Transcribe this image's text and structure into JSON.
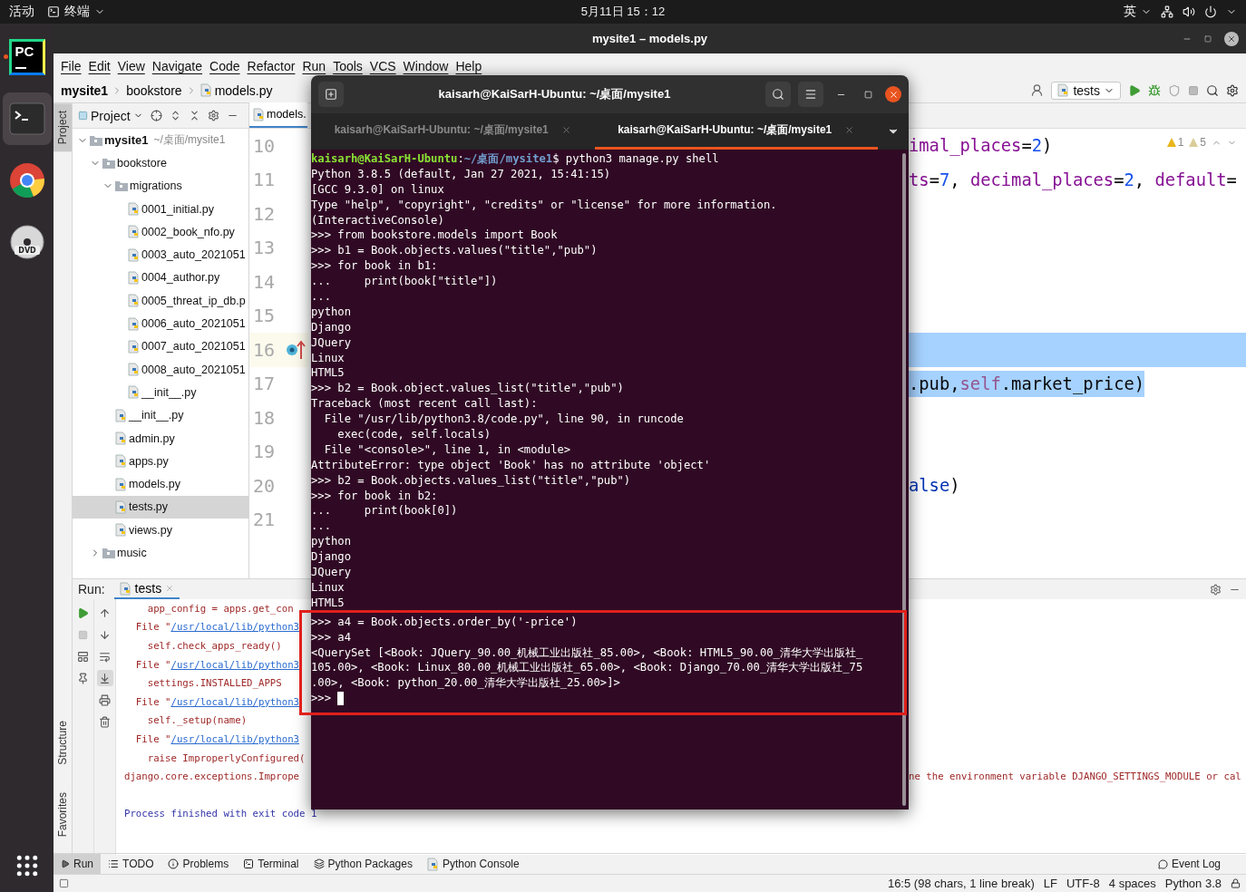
{
  "top_bar": {
    "activities": "活动",
    "app_menu": "终端",
    "clock": "5月11日 15：12",
    "input_method": "英"
  },
  "dock": {
    "items": [
      {
        "kind": "pycharm",
        "label": "PC",
        "running": true,
        "selected": false
      },
      {
        "kind": "terminal",
        "running": false,
        "selected": true
      },
      {
        "kind": "chrome",
        "running": false,
        "selected": false
      },
      {
        "kind": "dvd",
        "label": "DVD",
        "running": false,
        "selected": false
      }
    ]
  },
  "ide": {
    "title": "mysite1 – models.py",
    "menu": [
      "File",
      "Edit",
      "View",
      "Navigate",
      "Code",
      "Refactor",
      "Run",
      "Tools",
      "VCS",
      "Window",
      "Help"
    ],
    "breadcrumbs": [
      "mysite1",
      "bookstore",
      "models.py"
    ],
    "run_config": "tests",
    "side_tabs_top": [
      {
        "label": "Project",
        "selected": true
      }
    ],
    "side_tabs_bottom": [
      {
        "label": "Structure",
        "selected": false
      },
      {
        "label": "Favorites",
        "selected": false
      }
    ],
    "project_panel": {
      "title": "Project",
      "tree": [
        {
          "kind": "root",
          "name": "mysite1",
          "hint": "~/桌面/mysite1",
          "expanded": true,
          "selected": false,
          "children": [
            {
              "kind": "folder",
              "name": "bookstore",
              "expanded": true,
              "selected": false,
              "children": [
                {
                  "kind": "folder",
                  "name": "migrations",
                  "expanded": true,
                  "selected": false,
                  "children": [
                    {
                      "kind": "file",
                      "name": "0001_initial.py",
                      "selected": false
                    },
                    {
                      "kind": "file",
                      "name": "0002_book_nfo.py",
                      "selected": false
                    },
                    {
                      "kind": "file",
                      "name": "0003_auto_2021051",
                      "selected": false
                    },
                    {
                      "kind": "file",
                      "name": "0004_author.py",
                      "selected": false
                    },
                    {
                      "kind": "file",
                      "name": "0005_threat_ip_db.p",
                      "selected": false
                    },
                    {
                      "kind": "file",
                      "name": "0006_auto_2021051",
                      "selected": false
                    },
                    {
                      "kind": "file",
                      "name": "0007_auto_2021051",
                      "selected": false
                    },
                    {
                      "kind": "file",
                      "name": "0008_auto_2021051",
                      "selected": false
                    },
                    {
                      "kind": "file",
                      "name": "__init__.py",
                      "selected": false
                    }
                  ]
                },
                {
                  "kind": "file",
                  "name": "__init__.py",
                  "selected": false
                },
                {
                  "kind": "file",
                  "name": "admin.py",
                  "selected": false
                },
                {
                  "kind": "file",
                  "name": "apps.py",
                  "selected": false
                },
                {
                  "kind": "file",
                  "name": "models.py",
                  "selected": false
                },
                {
                  "kind": "file",
                  "name": "tests.py",
                  "selected": true
                },
                {
                  "kind": "file",
                  "name": "views.py",
                  "selected": false
                }
              ]
            },
            {
              "kind": "folder",
              "name": "music",
              "expanded": false,
              "selected": false
            }
          ]
        }
      ]
    },
    "editor": {
      "tab": "models.",
      "warnings": "1",
      "weak_warnings": "5",
      "lines": [
        {
          "number": "10",
          "current": false,
          "selected": false,
          "tokens": [
            {
              "text": "imal_places",
              "kind": "param"
            },
            {
              "text": "=",
              "kind": "op"
            },
            {
              "text": "2",
              "kind": "num"
            },
            {
              "text": ")",
              "kind": "op"
            }
          ]
        },
        {
          "number": "11",
          "current": false,
          "selected": false,
          "tokens": [
            {
              "text": "ts",
              "kind": "param"
            },
            {
              "text": "=",
              "kind": "op"
            },
            {
              "text": "7",
              "kind": "num"
            },
            {
              "text": ", ",
              "kind": "op"
            },
            {
              "text": "decimal_places",
              "kind": "param"
            },
            {
              "text": "=",
              "kind": "op"
            },
            {
              "text": "2",
              "kind": "num"
            },
            {
              "text": ", ",
              "kind": "op"
            },
            {
              "text": "default",
              "kind": "param"
            },
            {
              "text": "=",
              "kind": "op"
            }
          ]
        },
        {
          "number": "12",
          "current": false,
          "selected": false
        },
        {
          "number": "13",
          "current": false,
          "selected": false
        },
        {
          "number": "14",
          "current": false,
          "selected": false
        },
        {
          "number": "15",
          "current": false,
          "selected": false
        },
        {
          "number": "16",
          "current": true,
          "override_marker": true,
          "selected": true
        },
        {
          "number": "17",
          "current": false,
          "selected": true,
          "tokens": [
            {
              "text": ".pub,",
              "kind": "op"
            },
            {
              "text": "self",
              "kind": "self"
            },
            {
              "text": ".market_price)",
              "kind": "op"
            }
          ]
        },
        {
          "number": "18",
          "current": false,
          "selected": false
        },
        {
          "number": "19",
          "current": false,
          "selected": false
        },
        {
          "number": "20",
          "current": false,
          "selected": false,
          "tokens": [
            {
              "text": "alse",
              "kind": "kw"
            },
            {
              "text": ")",
              "kind": "op"
            }
          ]
        },
        {
          "number": "21",
          "current": false,
          "selected": false
        }
      ]
    },
    "run_panel": {
      "label": "Run:",
      "tab": "tests",
      "lines": [
        {
          "kind": "err",
          "text": "    app_config = apps.get_con"
        },
        {
          "kind": "file",
          "text": "  File \"",
          "link": "/usr/local/lib/python3"
        },
        {
          "kind": "err",
          "text": "    self.check_apps_ready()"
        },
        {
          "kind": "file",
          "text": "  File \"",
          "link": "/usr/local/lib/python3"
        },
        {
          "kind": "err",
          "text": "    settings.INSTALLED_APPS"
        },
        {
          "kind": "file",
          "text": "  File \"",
          "link": "/usr/local/lib/python3"
        },
        {
          "kind": "err",
          "text": "    self._setup(name)"
        },
        {
          "kind": "file",
          "text": "  File \"",
          "link": "/usr/local/lib/python3"
        },
        {
          "kind": "err",
          "text": "    raise ImproperlyConfigured("
        },
        {
          "kind": "err",
          "text": "django.core.exceptions.Imprope",
          "right": "ne the environment variable DJANGO_SETTINGS_MODULE or cal"
        },
        {
          "kind": "gap"
        },
        {
          "kind": "info",
          "text": "Process finished with exit code 1"
        }
      ]
    },
    "tool_tabs": [
      {
        "kind": "run",
        "label": "Run",
        "selected": true
      },
      {
        "kind": "todo",
        "label": "TODO",
        "selected": false
      },
      {
        "kind": "problems",
        "label": "Problems",
        "selected": false
      },
      {
        "kind": "terminal",
        "label": "Terminal",
        "selected": false
      },
      {
        "kind": "packages",
        "label": "Python Packages",
        "selected": false
      },
      {
        "kind": "console",
        "label": "Python Console",
        "selected": false
      }
    ],
    "event_log": "Event Log",
    "status": [
      "16:5 (98 chars, 1 line break)",
      "LF",
      "UTF-8",
      "4 spaces",
      "Python 3.8"
    ]
  },
  "terminal": {
    "title": "kaisarh@KaiSarH-Ubuntu: ~/桌面/mysite1",
    "tabs": [
      {
        "label": "kaisarh@KaiSarH-Ubuntu: ~/桌面/mysite1",
        "selected": false
      },
      {
        "label": "kaisarh@KaiSarH-Ubuntu: ~/桌面/mysite1",
        "selected": true
      }
    ],
    "lines": [
      {
        "kind": "prompt",
        "user": "kaisarh@KaiSarH-Ubuntu",
        "separator": ":",
        "path": "~/桌面/mysite1",
        "text": "$ python3 manage.py shell"
      },
      {
        "kind": "text",
        "text": "Python 3.8.5 (default, Jan 27 2021, 15:41:15)"
      },
      {
        "kind": "text",
        "text": "[GCC 9.3.0] on linux"
      },
      {
        "kind": "text",
        "text": "Type \"help\", \"copyright\", \"credits\" or \"license\" for more information."
      },
      {
        "kind": "text",
        "text": "(InteractiveConsole)"
      },
      {
        "kind": "text",
        "text": ">>> from bookstore.models import Book"
      },
      {
        "kind": "text",
        "text": ">>> b1 = Book.objects.values(\"title\",\"pub\")"
      },
      {
        "kind": "text",
        "text": ">>> for book in b1:"
      },
      {
        "kind": "text",
        "text": "...     print(book[\"title\"])"
      },
      {
        "kind": "text",
        "text": "..."
      },
      {
        "kind": "text",
        "text": "python"
      },
      {
        "kind": "text",
        "text": "Django"
      },
      {
        "kind": "text",
        "text": "JQuery"
      },
      {
        "kind": "text",
        "text": "Linux"
      },
      {
        "kind": "text",
        "text": "HTML5"
      },
      {
        "kind": "text",
        "text": ">>> b2 = Book.object.values_list(\"title\",\"pub\")"
      },
      {
        "kind": "text",
        "text": "Traceback (most recent call last):"
      },
      {
        "kind": "text",
        "text": "  File \"/usr/lib/python3.8/code.py\", line 90, in runcode"
      },
      {
        "kind": "text",
        "text": "    exec(code, self.locals)"
      },
      {
        "kind": "text",
        "text": "  File \"<console>\", line 1, in <module>"
      },
      {
        "kind": "text",
        "text": "AttributeError: type object 'Book' has no attribute 'object'"
      },
      {
        "kind": "text",
        "text": ">>> b2 = Book.objects.values_list(\"title\",\"pub\")"
      },
      {
        "kind": "text",
        "text": ">>> for book in b2:"
      },
      {
        "kind": "text",
        "text": "...     print(book[0])"
      },
      {
        "kind": "text",
        "text": "..."
      },
      {
        "kind": "text",
        "text": "python"
      },
      {
        "kind": "text",
        "text": "Django"
      },
      {
        "kind": "text",
        "text": "JQuery"
      },
      {
        "kind": "text",
        "text": "Linux"
      },
      {
        "kind": "text",
        "text": "HTML5"
      },
      {
        "kind": "framed",
        "text": ">>> a4 = Book.objects.order_by('-price')"
      },
      {
        "kind": "text",
        "text": ">>> a4"
      },
      {
        "kind": "text",
        "text": "<QuerySet [<Book: JQuery_90.00_机械工业出版社_85.00>, <Book: HTML5_90.00_清华大学出版社_"
      },
      {
        "kind": "text",
        "text": "105.00>, <Book: Linux_80.00_机械工业出版社_65.00>, <Book: Django_70.00_清华大学出版社_75"
      },
      {
        "kind": "text",
        "text": ".00>, <Book: python_20.00_清华大学出版社_25.00>]>"
      },
      {
        "kind": "input",
        "text": ">>> "
      }
    ]
  },
  "annotations": [
    {
      "kind": "frame"
    }
  ]
}
